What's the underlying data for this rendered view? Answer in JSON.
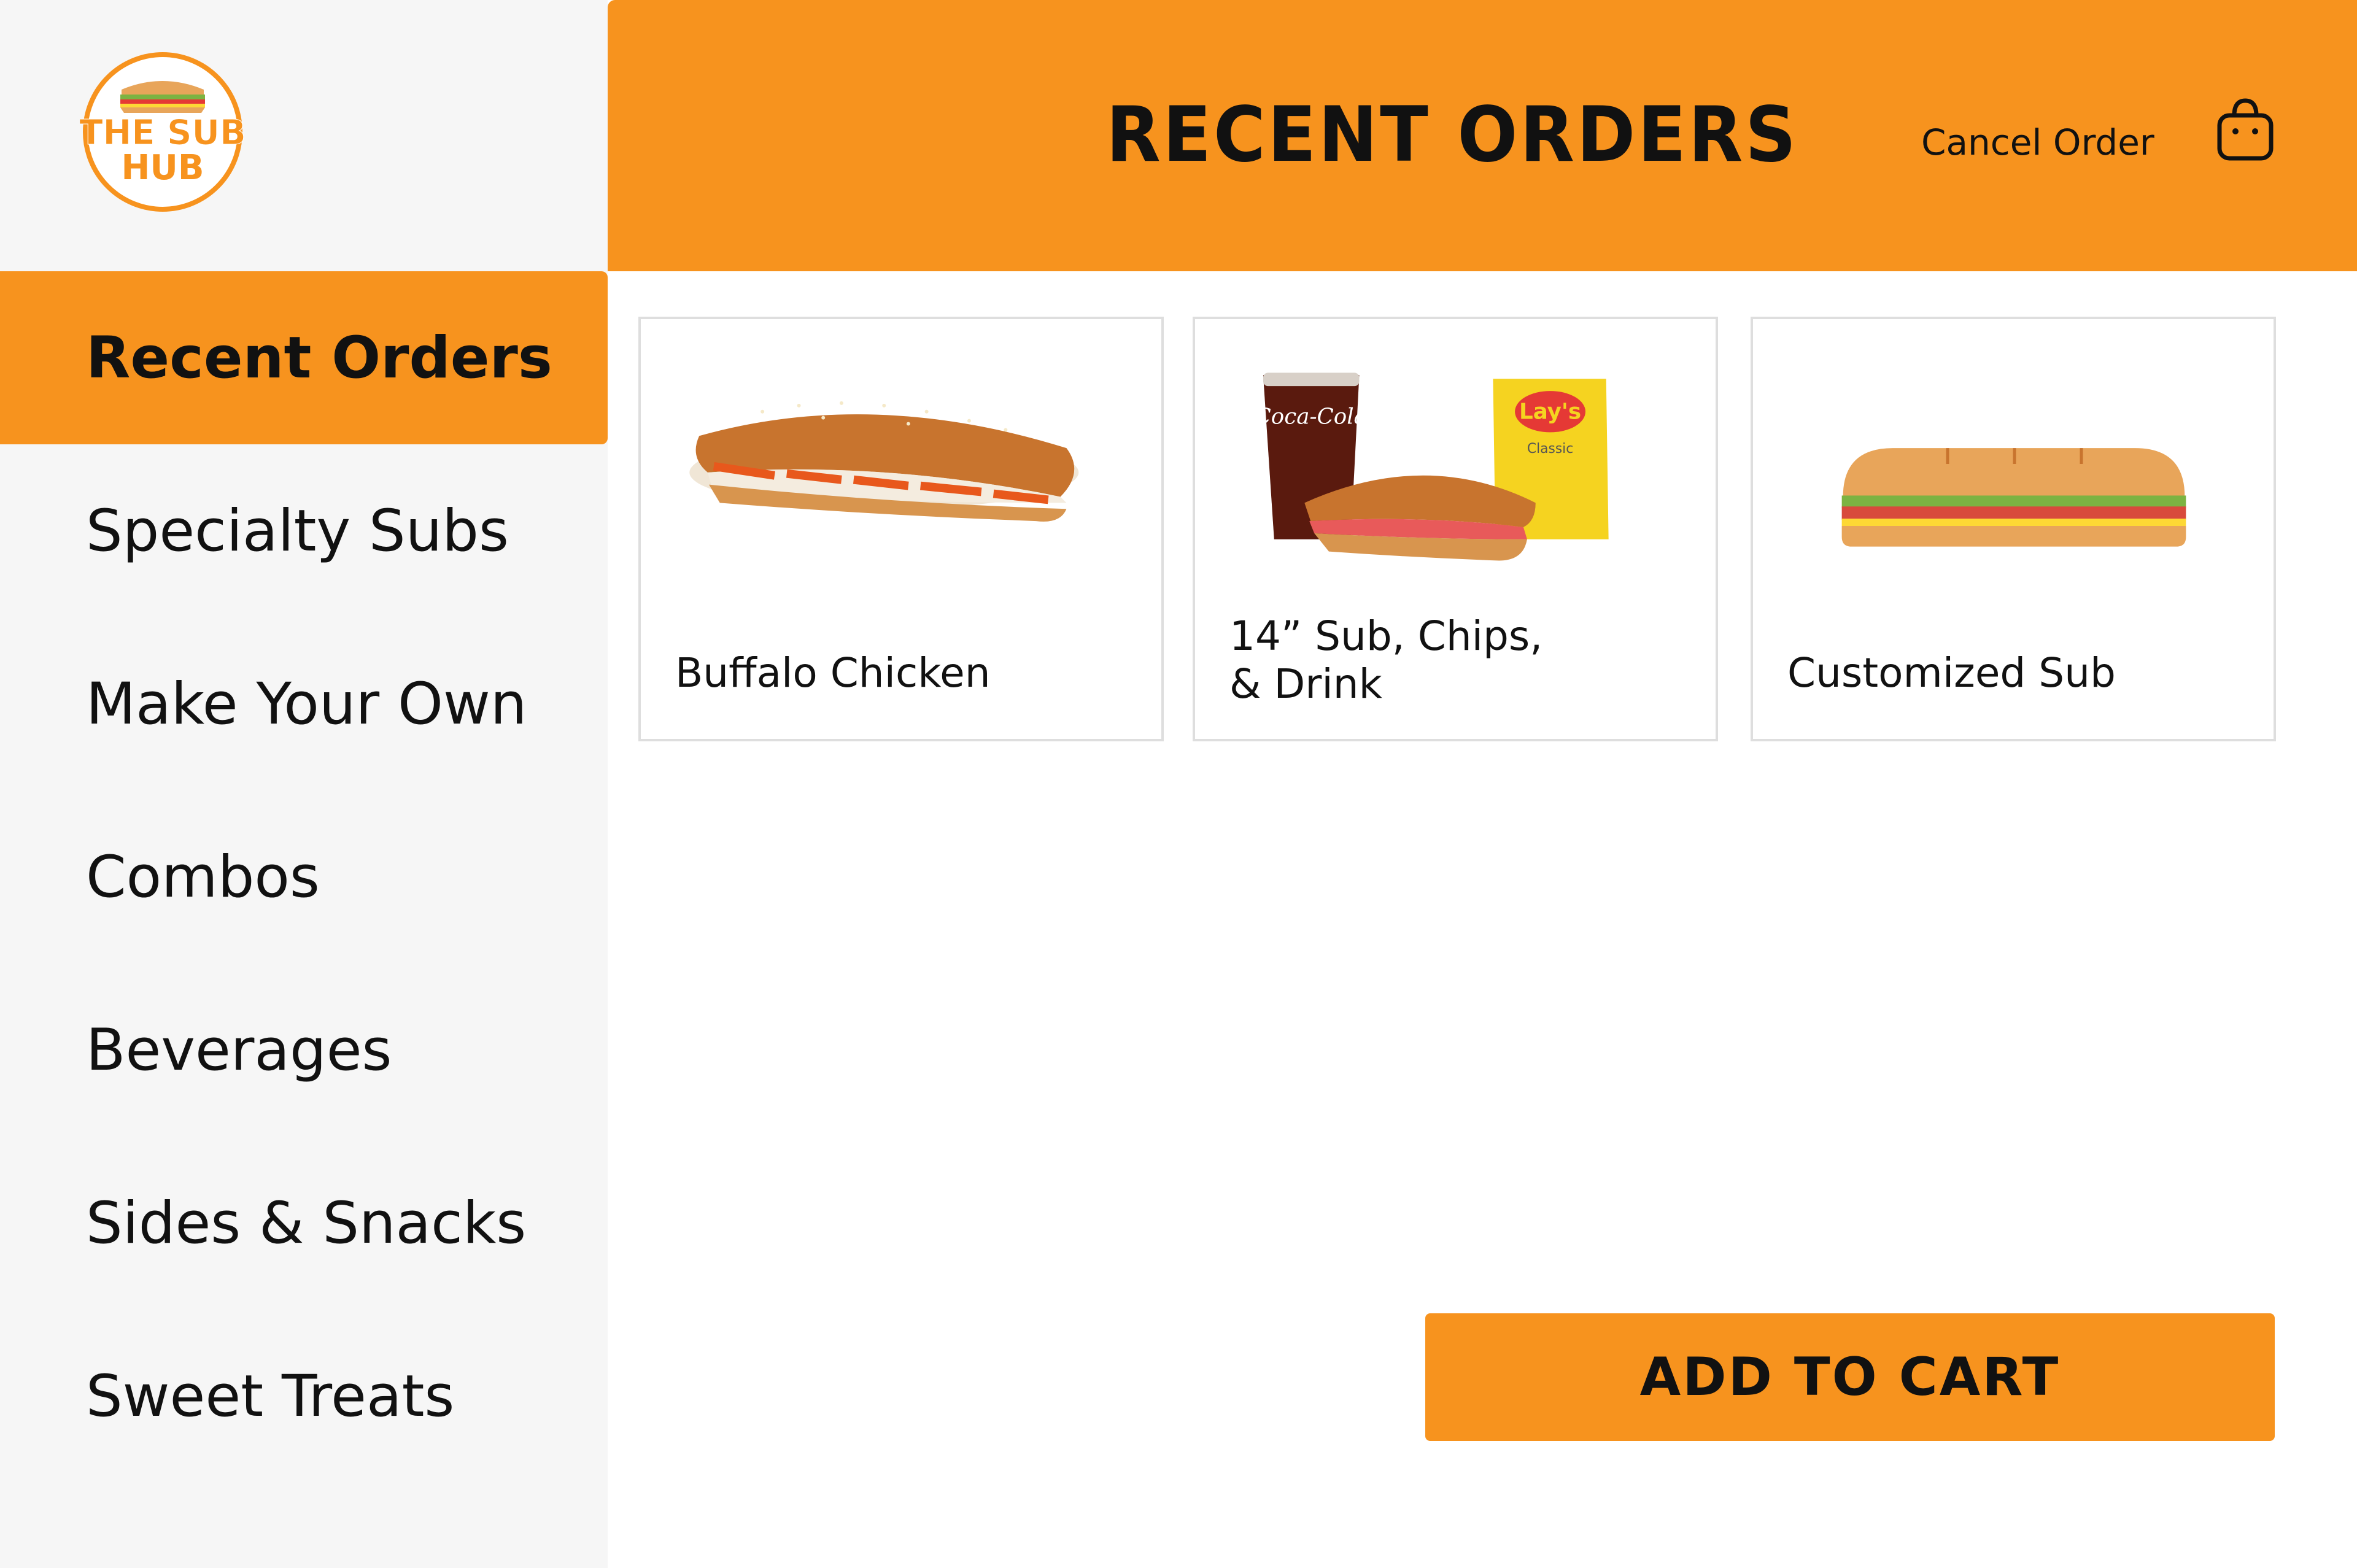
{
  "brand": {
    "name_line1": "THE SUB",
    "name_line2": "HUB"
  },
  "sidebar": {
    "items": [
      {
        "label": "Recent Orders",
        "active": true
      },
      {
        "label": "Specialty Subs",
        "active": false
      },
      {
        "label": "Make Your Own",
        "active": false
      },
      {
        "label": "Combos",
        "active": false
      },
      {
        "label": "Beverages",
        "active": false
      },
      {
        "label": "Sides & Snacks",
        "active": false
      },
      {
        "label": "Sweet Treats",
        "active": false
      }
    ]
  },
  "header": {
    "title": "RECENT ORDERS",
    "cancel_label": "Cancel Order",
    "cart_icon": "shopping-bag-icon"
  },
  "orders": [
    {
      "label": "Buffalo Chicken",
      "image": "buffalo-chicken-sub-image"
    },
    {
      "label": "14” Sub, Chips, & Drink",
      "image": "combo-meal-image",
      "drink_text": "Coca-Cola",
      "chips_text": "Lay's",
      "chips_sub": "Classic"
    },
    {
      "label": "Customized Sub",
      "image": "sub-illustration-image"
    }
  ],
  "actions": {
    "add_to_cart": "ADD TO CART"
  },
  "colors": {
    "accent": "#f7931e",
    "sidebar_bg": "#f6f6f6",
    "text": "#111111"
  }
}
